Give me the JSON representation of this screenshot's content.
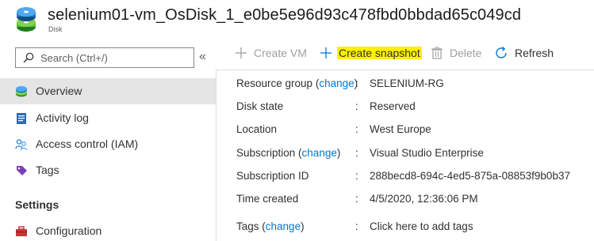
{
  "header": {
    "title": "selenium01-vm_OsDisk_1_e0be5e96d93c478fbd0bbdad65c049cd",
    "subtitle": "Disk"
  },
  "sidebar": {
    "search_placeholder": "Search (Ctrl+/)",
    "collapse_glyph": "«",
    "items": [
      {
        "label": "Overview",
        "icon": "disk-overview-icon",
        "active": true
      },
      {
        "label": "Activity log",
        "icon": "activity-log-icon"
      },
      {
        "label": "Access control (IAM)",
        "icon": "people-icon"
      },
      {
        "label": "Tags",
        "icon": "tag-icon"
      }
    ],
    "section_settings": "Settings",
    "settings_items": [
      {
        "label": "Configuration",
        "icon": "toolbox-icon"
      }
    ]
  },
  "toolbar": {
    "create_vm": "Create VM",
    "create_snapshot": "Create snapshot",
    "delete": "Delete",
    "refresh": "Refresh"
  },
  "essentials": {
    "change_label": "change",
    "colon": ":",
    "resource_group_key": "Resource group",
    "resource_group_value": "SELENIUM-RG",
    "disk_state_key": "Disk state",
    "disk_state_value": "Reserved",
    "location_key": "Location",
    "location_value": "West Europe",
    "subscription_key": "Subscription",
    "subscription_value": "Visual Studio Enterprise",
    "subscription_id_key": "Subscription ID",
    "subscription_id_value": "288becd8-694c-4ed5-875a-08853f9b0b37",
    "time_created_key": "Time created",
    "time_created_value": "4/5/2020, 12:36:06 PM",
    "tags_key": "Tags",
    "tags_value": "Click here to add tags"
  },
  "colors": {
    "link": "#0078d4",
    "highlight": "#fff100",
    "active_nav": "#e5e5e5"
  }
}
